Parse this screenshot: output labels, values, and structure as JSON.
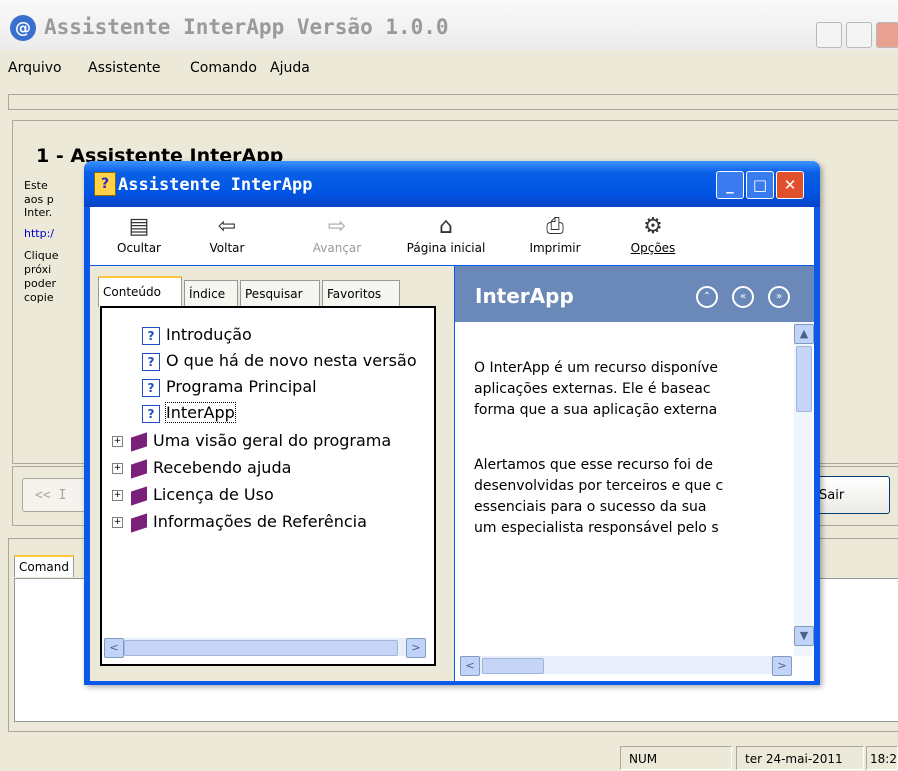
{
  "main_window": {
    "title": "Assistente InterApp Versão 1.0.0",
    "menu": [
      "Arquivo",
      "Assistente",
      "Comando",
      "Ajuda"
    ],
    "panel_heading": "1 - Assistente InterApp",
    "panel_text_lines": [
      "Este",
      "aos p",
      "Inter."
    ],
    "panel_link": "http:/",
    "panel_text2_lines": [
      "Clique",
      "próxi",
      "poder",
      "copie"
    ],
    "back_button": "<< I",
    "exit_button": "Sair",
    "command_tab": "Comand",
    "status": {
      "num": "NUM",
      "date": "ter 24-mai-2011",
      "time": "18:2"
    }
  },
  "help_window": {
    "title": "Assistente InterApp",
    "toolbar": [
      {
        "label": "Ocultar",
        "icon": "hide-icon",
        "disabled": false
      },
      {
        "label": "Voltar",
        "icon": "back-arrow-icon",
        "disabled": false
      },
      {
        "label": "Avançar",
        "icon": "forward-arrow-icon",
        "disabled": true
      },
      {
        "label": "Página inicial",
        "icon": "home-icon",
        "disabled": false
      },
      {
        "label": "Imprimir",
        "icon": "printer-icon",
        "disabled": false
      },
      {
        "label": "Opções",
        "icon": "options-icon",
        "disabled": false
      }
    ],
    "tabs": [
      "Conteúdo",
      "Índice",
      "Pesquisar",
      "Favoritos"
    ],
    "tree": [
      {
        "label": "Introdução",
        "type": "topic"
      },
      {
        "label": "O que há de novo nesta versão",
        "type": "topic"
      },
      {
        "label": "Programa Principal",
        "type": "topic"
      },
      {
        "label": "InterApp",
        "type": "topic",
        "selected": true
      },
      {
        "label": "Uma visão geral do programa",
        "type": "book"
      },
      {
        "label": "Recebendo ajuda",
        "type": "book"
      },
      {
        "label": "Licença de Uso",
        "type": "book"
      },
      {
        "label": "Informações de Referência",
        "type": "book"
      }
    ],
    "content": {
      "heading": "InterApp",
      "para1": [
        "O InterApp é um recurso disponíve",
        "aplicações externas. Ele é baseac",
        "forma que a sua aplicação externa"
      ],
      "para2": [
        "Alertamos que esse recurso foi de",
        "desenvolvidas por terceiros e que c",
        "essenciais para o sucesso da sua",
        "um especialista responsável pelo s"
      ]
    }
  }
}
